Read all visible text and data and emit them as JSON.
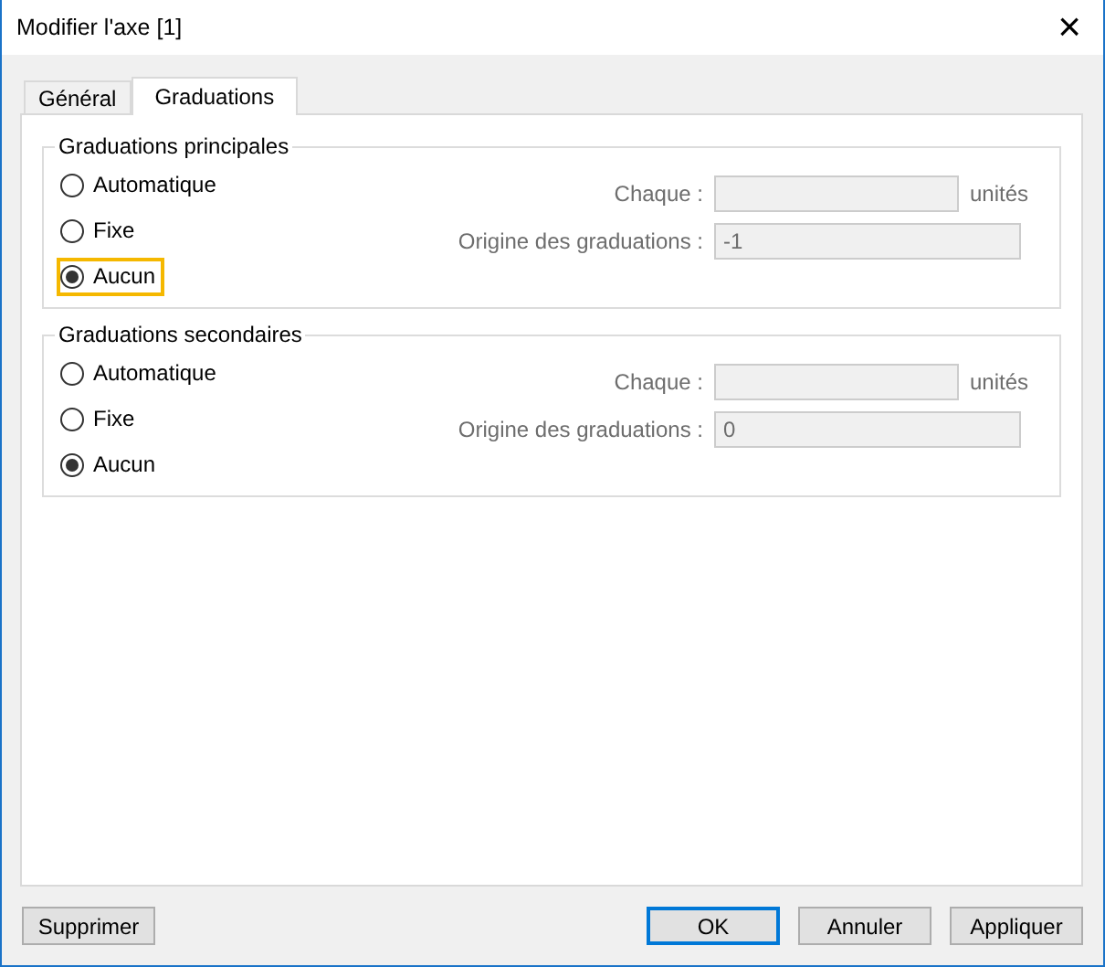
{
  "window": {
    "title": "Modifier l'axe [1]",
    "close": "×"
  },
  "tabs": [
    {
      "label": "Général",
      "selected": false
    },
    {
      "label": "Graduations",
      "selected": true
    }
  ],
  "groups": [
    {
      "title": "Graduations principales",
      "options": [
        {
          "label": "Automatique",
          "selected": false,
          "highlighted": false
        },
        {
          "label": "Fixe",
          "selected": false,
          "highlighted": false
        },
        {
          "label": "Aucun",
          "selected": true,
          "highlighted": true
        }
      ],
      "fields": [
        {
          "label": "Chaque :",
          "disabled": true,
          "unit": "unités"
        },
        {
          "label": "Origine des graduations :",
          "value": "-1",
          "disabled": true
        }
      ]
    },
    {
      "title": "Graduations secondaires",
      "options": [
        {
          "label": "Automatique",
          "selected": false,
          "highlighted": false
        },
        {
          "label": "Fixe",
          "selected": false,
          "highlighted": false
        },
        {
          "label": "Aucun",
          "selected": true,
          "highlighted": false
        }
      ],
      "fields": [
        {
          "label": "Chaque :",
          "disabled": true,
          "unit": "unités"
        },
        {
          "label": "Origine des graduations :",
          "value": "0",
          "disabled": true
        }
      ]
    }
  ],
  "buttons_left": [
    {
      "label": "Supprimer",
      "default": false
    }
  ],
  "buttons_right": [
    {
      "label": "OK",
      "default": true
    },
    {
      "label": "Annuler",
      "default": false
    },
    {
      "label": "Appliquer",
      "default": false
    }
  ]
}
